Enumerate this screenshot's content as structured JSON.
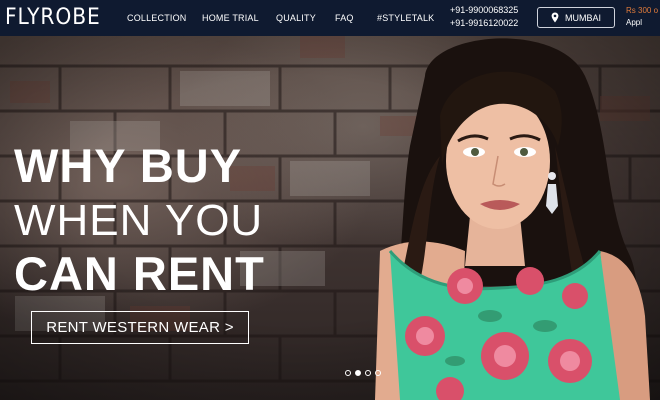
{
  "brand": {
    "logo_text": "FLYROBE"
  },
  "nav": {
    "items": [
      {
        "label": "COLLECTION"
      },
      {
        "label": "HOME TRIAL"
      },
      {
        "label": "QUALITY"
      },
      {
        "label": "FAQ"
      },
      {
        "label": "#STYLETALK"
      }
    ],
    "phones": [
      "+91-9900068325",
      "+91-9916120022"
    ],
    "city_button": {
      "label": "MUMBAI",
      "icon": "location-pin-icon"
    },
    "promo": {
      "line1": "Rs 300 o",
      "line2": "Appl"
    }
  },
  "hero": {
    "headline": [
      "WHY BUY",
      "WHEN YOU",
      "CAN RENT"
    ],
    "cta_label": "RENT WESTERN WEAR >",
    "carousel": {
      "total": 4,
      "active_index": 1
    }
  },
  "colors": {
    "nav_bg": "#0f1a30",
    "promo_accent": "#e07b3b",
    "dress_green": "#3fc79a",
    "rose_pink": "#d9506a"
  }
}
